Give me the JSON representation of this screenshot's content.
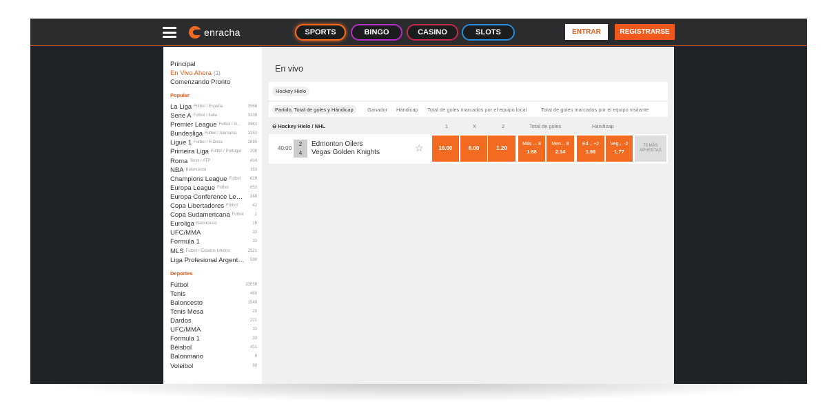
{
  "header": {
    "logo_text": "enracha",
    "nav": [
      {
        "label": "SPORTS",
        "color": "#f26b21"
      },
      {
        "label": "BINGO",
        "color": "#b42fc4"
      },
      {
        "label": "CASINO",
        "color": "#c4284b"
      },
      {
        "label": "SLOTS",
        "color": "#2a8cdc"
      }
    ],
    "login_label": "ENTRAR",
    "register_label": "REGISTRARSE"
  },
  "sidebar": {
    "links": [
      {
        "label": "Principal"
      },
      {
        "label": "En Vivo Ahora",
        "count": "(1)"
      },
      {
        "label": "Comenzando Pronto"
      }
    ],
    "popular_heading": "Popular",
    "popular": [
      {
        "name": "La Liga",
        "sub": "Fútbol / España",
        "count": "3566"
      },
      {
        "name": "Serie A",
        "sub": "Fútbol / Italia",
        "count": "3338"
      },
      {
        "name": "Premier League",
        "sub": "Fútbol / In...",
        "count": "3963"
      },
      {
        "name": "Bundesliga",
        "sub": "Fútbol / Alemania",
        "count": "3153"
      },
      {
        "name": "Ligue 1",
        "sub": "Fútbol / Francia",
        "count": "2895"
      },
      {
        "name": "Primeira Liga",
        "sub": "Fútbol / Portugal",
        "count": "208"
      },
      {
        "name": "Roma",
        "sub": "Tenis / ATP",
        "count": "414"
      },
      {
        "name": "NBA",
        "sub": "Baloncesto",
        "count": "353"
      },
      {
        "name": "Champions League",
        "sub": "Fútbol",
        "count": "629"
      },
      {
        "name": "Europa League",
        "sub": "Fútbol",
        "count": "653"
      },
      {
        "name": "Europa Conference Lea...",
        "sub": "",
        "count": "368"
      },
      {
        "name": "Copa Libertadores",
        "sub": "Fútbol",
        "count": "42"
      },
      {
        "name": "Copa Sudamericana",
        "sub": "Fútbol",
        "count": "1"
      },
      {
        "name": "Euroliga",
        "sub": "Baloncesto",
        "count": "15"
      },
      {
        "name": "UFC/MMA",
        "sub": "",
        "count": "33"
      },
      {
        "name": "Formula 1",
        "sub": "",
        "count": "33"
      },
      {
        "name": "MLS",
        "sub": "Fútbol / Estados Unidos",
        "count": "2521"
      },
      {
        "name": "Liga Profesional Argenti...",
        "sub": "",
        "count": "598"
      }
    ],
    "sports_heading": "Deportes",
    "sports": [
      {
        "name": "Fútbol",
        "count": "33056"
      },
      {
        "name": "Tenis",
        "count": "460"
      },
      {
        "name": "Baloncesto",
        "count": "1549"
      },
      {
        "name": "Tenis Mesa",
        "count": "20"
      },
      {
        "name": "Dardos",
        "count": "231"
      },
      {
        "name": "UFC/MMA",
        "count": "33"
      },
      {
        "name": "Formula 1",
        "count": "33"
      },
      {
        "name": "Béisbol",
        "count": "431"
      },
      {
        "name": "Balonmano",
        "count": "6"
      },
      {
        "name": "Voleibol",
        "count": "99"
      }
    ]
  },
  "main": {
    "title": "En vivo",
    "chip": "Hockey Hielo",
    "tabs": [
      "Partido, Total de goles y Hándicap",
      "Ganador",
      "Hándicap",
      "Total de goles marcados por el equipo local",
      "Total de goles marcados por el equipo visitante"
    ],
    "group": {
      "label": "⊖ Hockey Hielo / NHL",
      "col_1": "1",
      "col_x": "X",
      "col_2": "2",
      "col_total": "Total de goles",
      "col_handicap": "Hándicap"
    },
    "event": {
      "time": "40:00",
      "score_home": "2",
      "score_away": "4",
      "home": "Edmonton Oilers",
      "away": "Vegas Golden Knights",
      "odds_1": "16.00",
      "odds_x": "6.00",
      "odds_2": "1.20",
      "total_over_label": "Más ... 8",
      "total_over": "1.68",
      "total_under_label": "Men... 8",
      "total_under": "2.14",
      "hcp_home_label": "Ed... +2",
      "hcp_home": "1.98",
      "hcp_away_label": "Veg... -2",
      "hcp_away": "1.77",
      "more_line1": "75 MÁS",
      "more_line2": "APUESTAS"
    }
  },
  "colors": {
    "accent": "#f26b21",
    "background": "#1f2227",
    "topbar": "#2a2c2e"
  }
}
